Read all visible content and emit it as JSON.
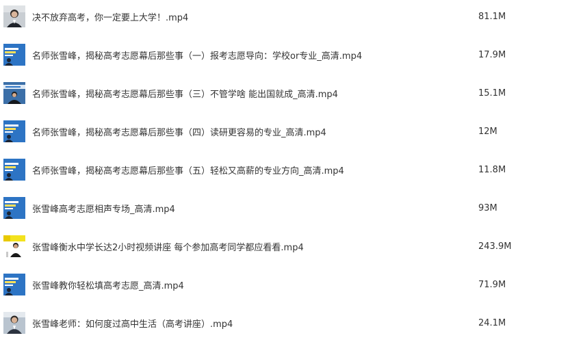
{
  "files": [
    {
      "name": "决不放弃高考，你一定要上大学！.mp4",
      "size": "81.1M",
      "thumbnail": "video-thumbnail-portrait-icon"
    },
    {
      "name": "名师张雪峰，揭秘高考志愿幕后那些事（一）报考志愿导向：学校or专业_高清.mp4",
      "size": "17.9M",
      "thumbnail": "video-thumbnail-blue-title-icon"
    },
    {
      "name": "名师张雪峰，揭秘高考志愿幕后那些事（三）不管学啥 能出国就成_高清.mp4",
      "size": "15.1M",
      "thumbnail": "video-thumbnail-blue-speaker-icon"
    },
    {
      "name": "名师张雪峰，揭秘高考志愿幕后那些事（四）读研更容易的专业_高清.mp4",
      "size": "12M",
      "thumbnail": "video-thumbnail-blue-title-icon"
    },
    {
      "name": "名师张雪峰，揭秘高考志愿幕后那些事（五）轻松又高薪的专业方向_高清.mp4",
      "size": "11.8M",
      "thumbnail": "video-thumbnail-blue-title-icon"
    },
    {
      "name": "张雪峰高考志愿相声专场_高清.mp4",
      "size": "93M",
      "thumbnail": "video-thumbnail-blue-title-icon"
    },
    {
      "name": "张雪峰衡水中学长达2小时视频讲座 每个参加高考同学都应看看.mp4",
      "size": "243.9M",
      "thumbnail": "video-thumbnail-yellow-stage-icon"
    },
    {
      "name": "张雪峰教你轻松填高考志愿_高清.mp4",
      "size": "71.9M",
      "thumbnail": "video-thumbnail-blue-title-icon"
    },
    {
      "name": "张雪峰老师：如何度过高中生活（高考讲座）.mp4",
      "size": "24.1M",
      "thumbnail": "video-thumbnail-portrait-icon"
    }
  ]
}
